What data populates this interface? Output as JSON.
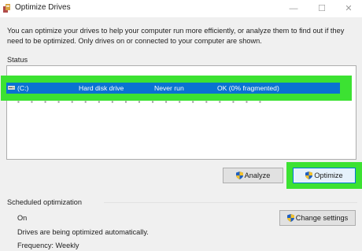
{
  "window": {
    "title": "Optimize Drives",
    "minimize_glyph": "—",
    "maximize_glyph": "☐",
    "close_glyph": "✕"
  },
  "description": "You can optimize your drives to help your computer run more efficiently, or analyze them to find out if they need to be optimized. Only drives on or connected to your computer are shown.",
  "status": {
    "label": "Status",
    "drive": {
      "name": "(C:)",
      "media_type": "Hard disk drive",
      "last_run": "Never run",
      "current_status": "OK (0% fragmented)"
    }
  },
  "buttons": {
    "analyze": "Analyze",
    "optimize": "Optimize",
    "change_settings": "Change settings"
  },
  "scheduled": {
    "label": "Scheduled optimization",
    "state": "On",
    "message": "Drives are being optimized automatically.",
    "frequency": "Frequency: Weekly"
  },
  "colors": {
    "highlight": "#3ce232",
    "selection": "#0a72d2"
  },
  "icons": {
    "app": "optimize-drives-icon",
    "drive": "hard-disk-icon",
    "shield": "uac-shield-icon"
  }
}
